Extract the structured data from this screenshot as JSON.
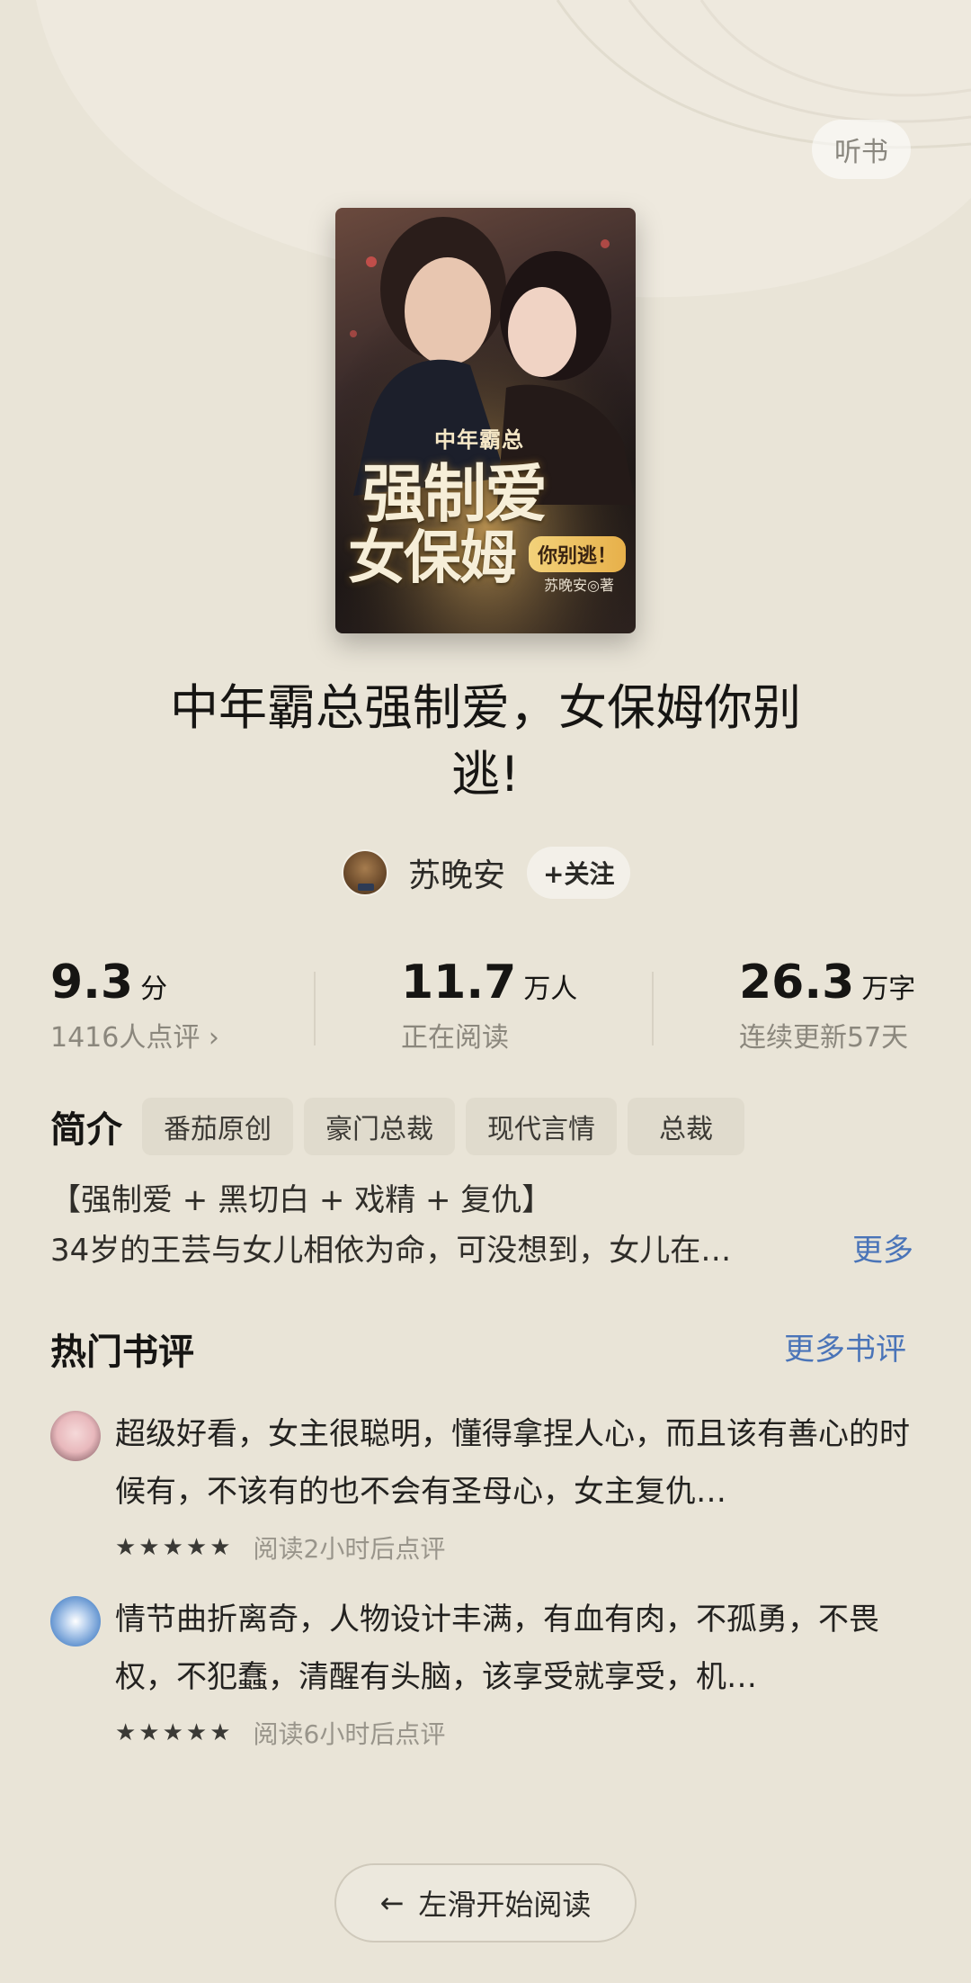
{
  "header": {
    "listen_label": "听书"
  },
  "cover": {
    "series_text": "中年霸总",
    "title_line_1": "强制爱",
    "title_line_2": "女保姆",
    "tag_text": "你别逃！",
    "author_text": "苏晚安◎著"
  },
  "book": {
    "title_line_1": "中年霸总强制爱，女保姆你别",
    "title_line_2": "逃!"
  },
  "author": {
    "name": "苏晚安",
    "follow_label": "+关注"
  },
  "stats": [
    {
      "value": "9.3",
      "unit": "分",
      "sub": "1416人点评 ›"
    },
    {
      "value": "11.7",
      "unit": "万人",
      "sub": "正在阅读"
    },
    {
      "value": "26.3",
      "unit": "万字",
      "sub": "连续更新57天"
    }
  ],
  "intro": {
    "label": "简介",
    "tags": [
      "番茄原创",
      "豪门总裁",
      "现代言情",
      "总裁"
    ],
    "line_1": "【强制爱 + 黑切白 + 戏精 + 复仇】",
    "line_2": "34岁的王芸与女儿相依为命，可没想到，女儿在…",
    "more_label": "更多"
  },
  "reviews": {
    "heading": "热门书评",
    "more_label": "更多书评",
    "items": [
      {
        "text": "超级好看，女主很聪明，懂得拿捏人心，而且该有善心的时候有，不该有的也不会有圣母心，女主复仇…",
        "stars": "★★★★★",
        "meta": "阅读2小时后点评"
      },
      {
        "text": "情节曲折离奇，人物设计丰满，有血有肉，不孤勇，不畏权，不犯蠢，清醒有头脑，该享受就享受，机…",
        "stars": "★★★★★",
        "meta": "阅读6小时后点评"
      }
    ]
  },
  "footer": {
    "start_label": "左滑开始阅读",
    "arrow_icon": "←"
  },
  "colors": {
    "background": "#e9e4d7",
    "link": "#4a74b8",
    "muted": "#8b877d"
  }
}
